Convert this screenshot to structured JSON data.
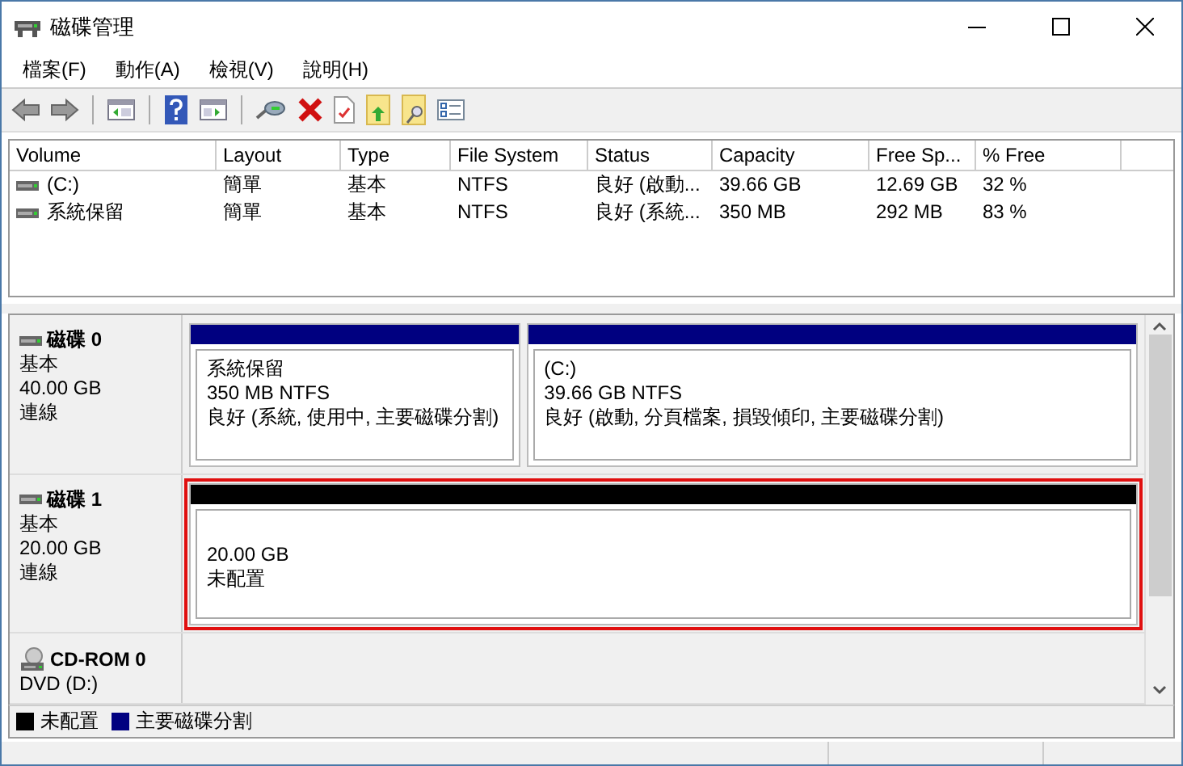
{
  "window": {
    "title": "磁碟管理"
  },
  "menu": [
    "檔案(F)",
    "動作(A)",
    "檢視(V)",
    "說明(H)"
  ],
  "toolbar": [
    {
      "kind": "back",
      "disabled": true
    },
    {
      "kind": "forward",
      "disabled": true
    },
    {
      "kind": "sep"
    },
    {
      "kind": "console"
    },
    {
      "kind": "sep"
    },
    {
      "kind": "help"
    },
    {
      "kind": "pane"
    },
    {
      "kind": "sep"
    },
    {
      "kind": "connect"
    },
    {
      "kind": "delete"
    },
    {
      "kind": "properties"
    },
    {
      "kind": "folder-up"
    },
    {
      "kind": "folder-search"
    },
    {
      "kind": "list"
    }
  ],
  "table": {
    "columns": [
      "Volume",
      "Layout",
      "Type",
      "File System",
      "Status",
      "Capacity",
      "Free Sp...",
      "% Free"
    ],
    "rows": [
      {
        "cells": [
          "(C:)",
          "簡單",
          "基本",
          "NTFS",
          "良好 (啟動...",
          "39.66 GB",
          "12.69 GB",
          "32 %"
        ]
      },
      {
        "cells": [
          "系統保留",
          "簡單",
          "基本",
          "NTFS",
          "良好 (系統...",
          "350 MB",
          "292 MB",
          "83 %"
        ]
      }
    ]
  },
  "disks": [
    {
      "kind": "disk",
      "name": "磁碟 0",
      "lines": [
        "基本",
        "40.00 GB",
        "連線"
      ],
      "highlighted": false,
      "partitions": [
        {
          "kind": "primary",
          "lines": [
            "系統保留",
            "350 MB NTFS",
            "良好 (系統, 使用中, 主要磁碟分割)"
          ]
        },
        {
          "kind": "primary",
          "lines": [
            "(C:)",
            "39.66 GB NTFS",
            "良好 (啟動, 分頁檔案, 損毀傾印, 主要磁碟分割)"
          ]
        }
      ]
    },
    {
      "kind": "disk",
      "name": "磁碟 1",
      "lines": [
        "基本",
        "20.00 GB",
        "連線"
      ],
      "highlighted": true,
      "partitions": [
        {
          "kind": "unallocated",
          "lines": [
            "20.00 GB",
            "未配置"
          ]
        }
      ]
    },
    {
      "kind": "cdrom",
      "name": "CD-ROM 0",
      "lines": [
        "DVD (D:)"
      ],
      "highlighted": false
    }
  ],
  "legend": [
    {
      "label": "未配置",
      "color": "#000000"
    },
    {
      "label": "主要磁碟分割",
      "color": "#000080"
    }
  ]
}
